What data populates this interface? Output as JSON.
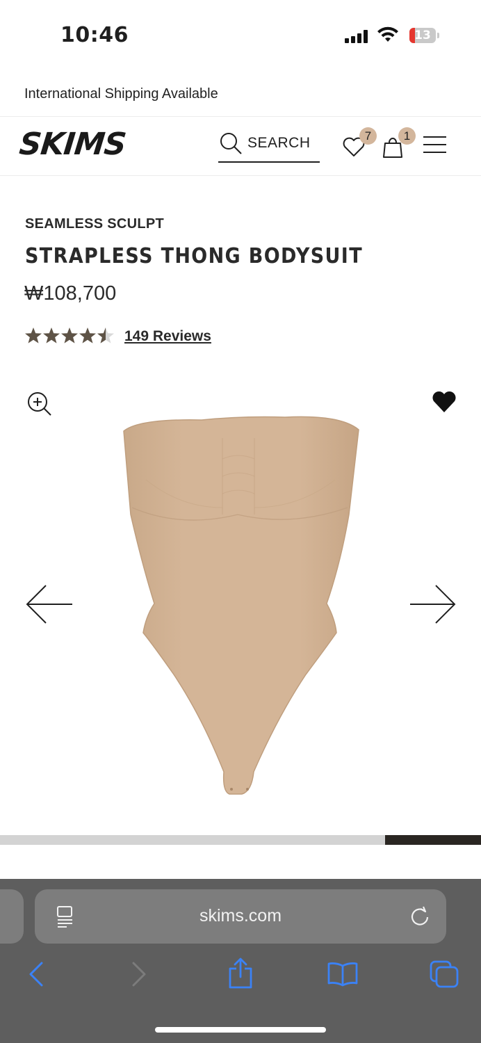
{
  "status_bar": {
    "time": "10:46",
    "battery": "13"
  },
  "banner": {
    "text": "International Shipping Available"
  },
  "header": {
    "logo": "SKIMS",
    "search_label": "SEARCH",
    "wishlist_count": "7",
    "bag_count": "1"
  },
  "product": {
    "collection": "SEAMLESS SCULPT",
    "name": "STRAPLESS THONG BODYSUIT",
    "price": "₩108,700",
    "rating": 4.5,
    "reviews_label": "149 Reviews"
  },
  "gallery": {
    "progress": 0.2
  },
  "browser": {
    "url": "skims.com"
  },
  "colors": {
    "accent_badge": "#d3b69c",
    "product": "#d2b294",
    "browser_blue": "#3b82f6"
  },
  "icons": [
    "search-icon",
    "heart-outline-icon",
    "bag-icon",
    "menu-icon",
    "zoom-in-icon",
    "heart-filled-icon",
    "arrow-left-icon",
    "arrow-right-icon",
    "reader-icon",
    "reload-icon",
    "back-icon",
    "forward-icon",
    "share-icon",
    "bookmarks-icon",
    "tabs-icon"
  ]
}
